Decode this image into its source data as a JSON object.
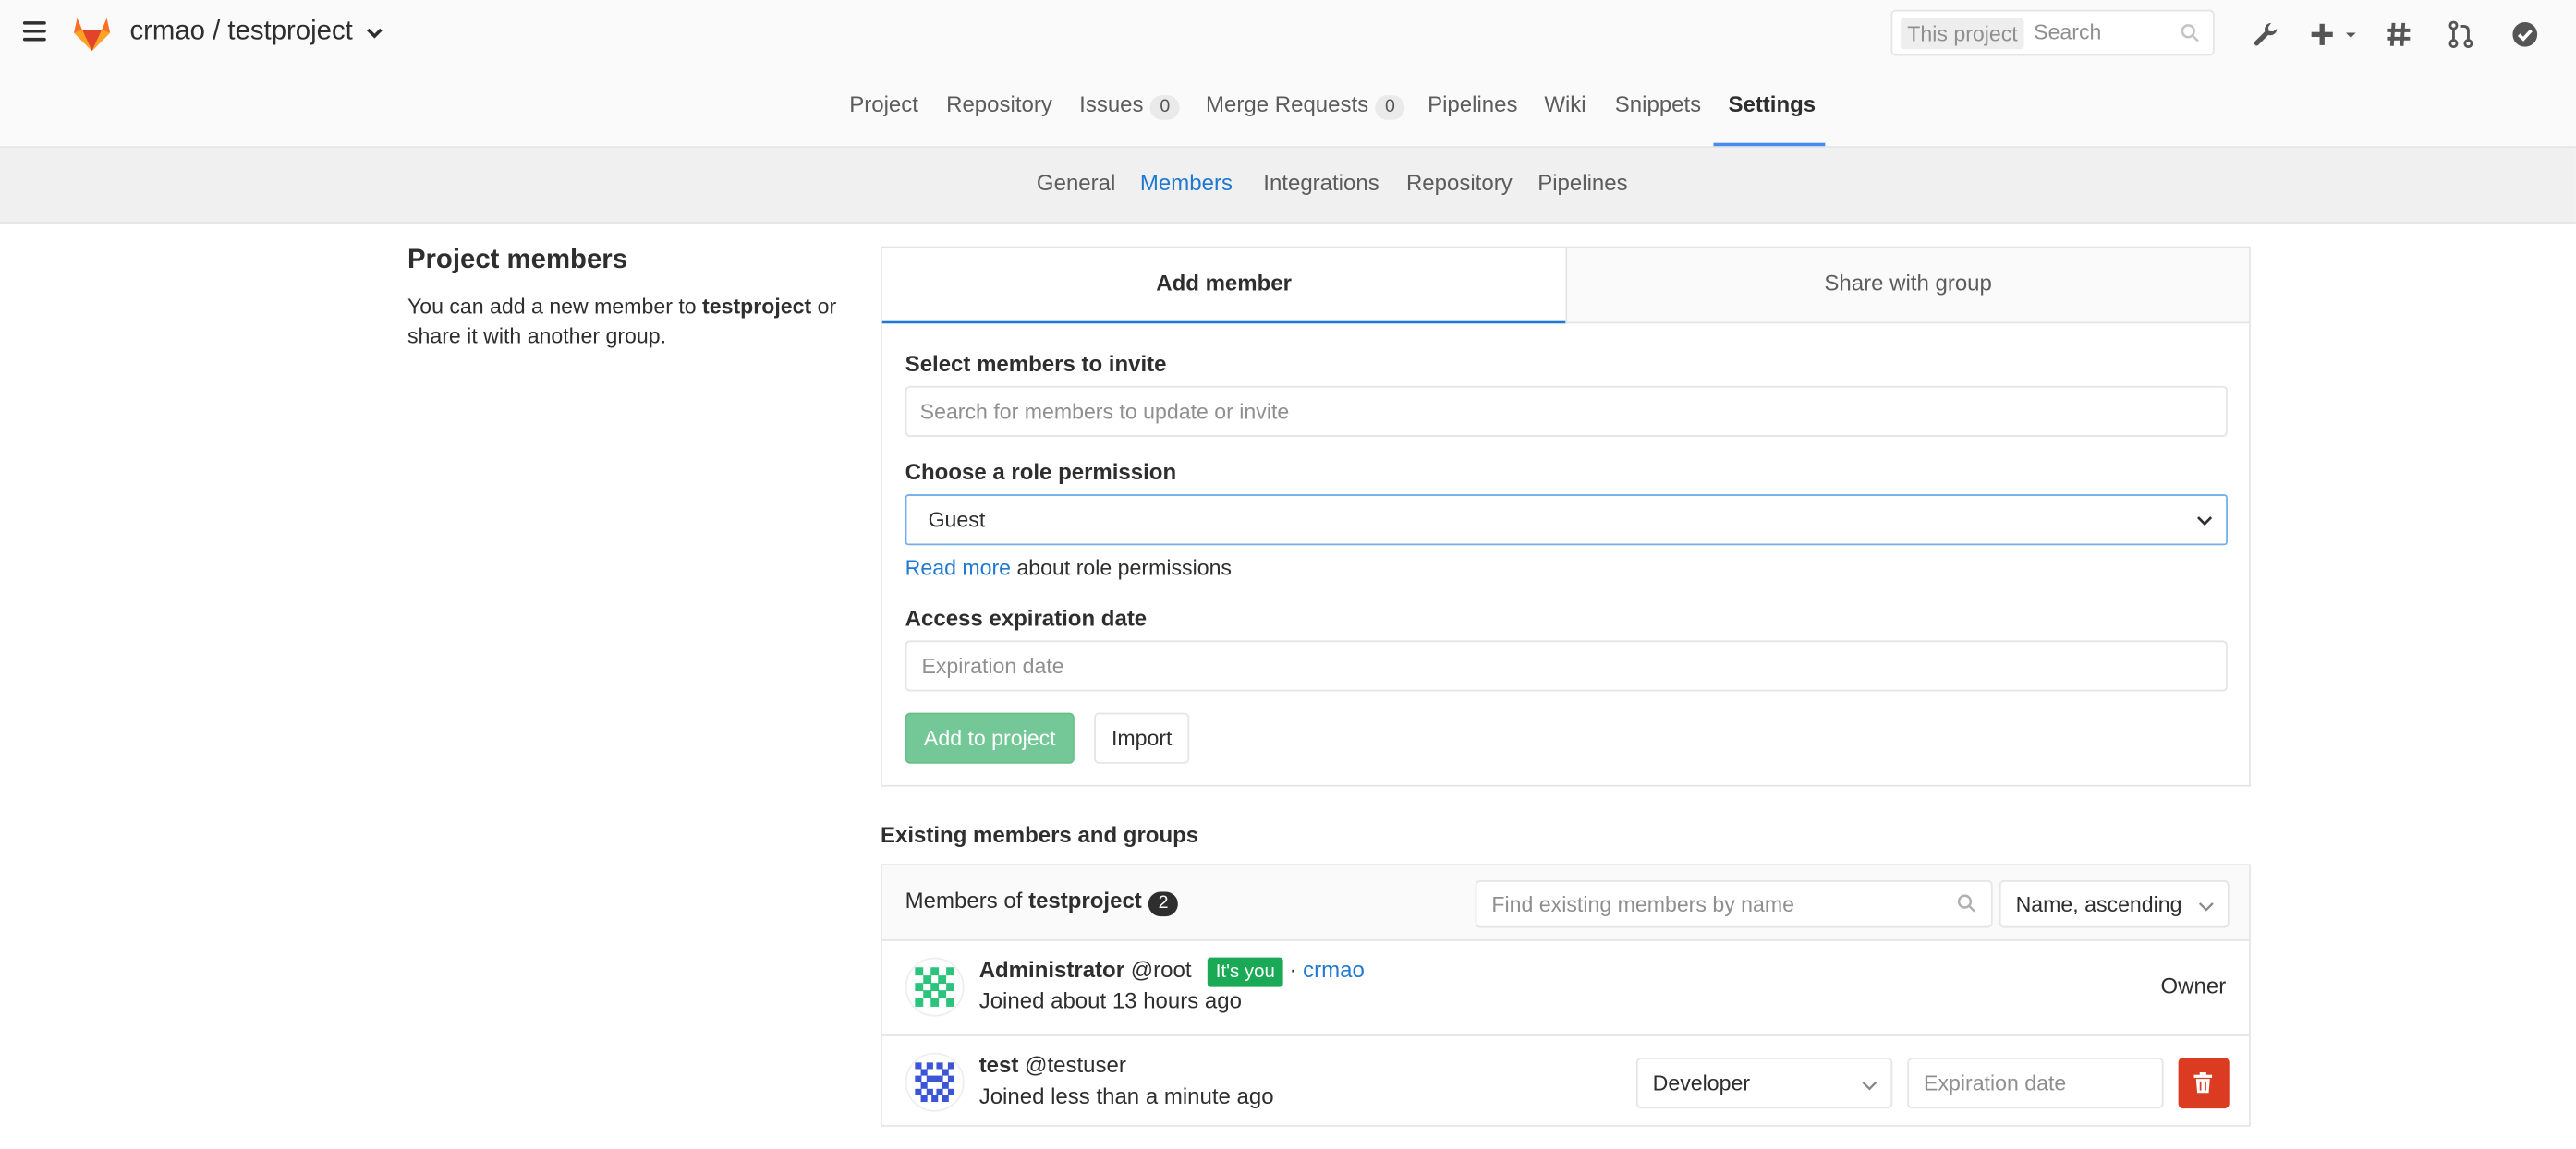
{
  "header": {
    "project_path": "crmao / testproject",
    "search_scope": "This project",
    "search_placeholder": "Search"
  },
  "nav": {
    "items": [
      {
        "label": "Project"
      },
      {
        "label": "Repository"
      },
      {
        "label": "Issues",
        "badge": "0"
      },
      {
        "label": "Merge Requests",
        "badge": "0"
      },
      {
        "label": "Pipelines"
      },
      {
        "label": "Wiki"
      },
      {
        "label": "Snippets"
      },
      {
        "label": "Settings",
        "active": true
      }
    ]
  },
  "subnav": {
    "items": [
      {
        "label": "General"
      },
      {
        "label": "Members",
        "active": true
      },
      {
        "label": "Integrations"
      },
      {
        "label": "Repository"
      },
      {
        "label": "Pipelines"
      }
    ]
  },
  "left": {
    "title": "Project members",
    "desc_before": "You can add a new member to ",
    "desc_project": "testproject",
    "desc_after": " or share it with another group."
  },
  "add_panel": {
    "tab_add": "Add member",
    "tab_share": "Share with group",
    "select_label": "Select members to invite",
    "select_placeholder": "Search for members to update or invite",
    "role_label": "Choose a role permission",
    "role_value": "Guest",
    "read_more_link": "Read more",
    "read_more_rest": " about role permissions",
    "expiry_label": "Access expiration date",
    "expiry_placeholder": "Expiration date",
    "add_button": "Add to project",
    "import_button": "Import"
  },
  "existing": {
    "title": "Existing members and groups",
    "members_of_label": "Members of ",
    "project": "testproject",
    "count": "2",
    "find_placeholder": "Find existing members by name",
    "sort_value": "Name, ascending",
    "members": [
      {
        "name": "Administrator",
        "username": "@root",
        "badge": "It's you",
        "group_sep": "·",
        "group": "crmao",
        "joined": "Joined about 13 hours ago",
        "role": "Owner"
      },
      {
        "name": "test",
        "username": "@testuser",
        "joined": "Joined less than a minute ago",
        "role": "Developer",
        "expiry_placeholder": "Expiration date"
      }
    ]
  },
  "colors": {
    "accent_blue": "#1f78d1",
    "success_green": "#1aaa55",
    "danger_red": "#db3b21"
  }
}
